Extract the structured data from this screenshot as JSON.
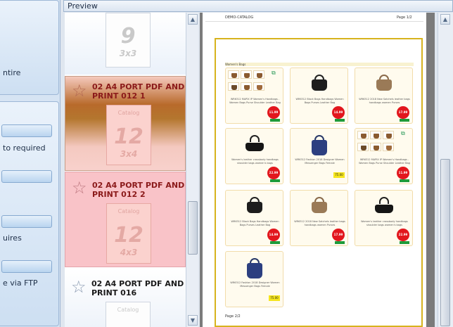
{
  "left_panel": {
    "texts": [
      "ntire",
      "to required",
      "uires",
      "e via FTP"
    ]
  },
  "preview": {
    "title": "Preview"
  },
  "templates": [
    {
      "title": "",
      "thumb_number": "9",
      "thumb_grid": "3x3",
      "selected": false
    },
    {
      "title": "02 A4 PORT PDF AND PRINT 012 1",
      "thumb_caption": "Catalog",
      "thumb_number": "12",
      "thumb_grid": "3x4",
      "selected": true
    },
    {
      "title": "02 A4 PORT PDF AND PRINT 012 2",
      "thumb_caption": "Catalog",
      "thumb_number": "12",
      "thumb_grid": "4x3",
      "selected": false,
      "hovered": true
    },
    {
      "title": "02 A4 PORT PDF AND PRINT 016",
      "thumb_caption": "Catalog",
      "selected": false
    }
  ],
  "page_preview": {
    "header_left": "DEMO-CATALOG",
    "header_right": "Page 1/2",
    "category_title": "Women's Bags",
    "footer_left": "Page 2/2",
    "cards": [
      {
        "desc": "WR6312 MAPIX IP Women's Handbags - Women Bags Purse Shoulder Leather Bag",
        "price": "11.99",
        "badge": "red"
      },
      {
        "desc": "WR6312 Black Bags Handbags Women Bags Purses Leather Bag",
        "price": "14.99",
        "badge": "red"
      },
      {
        "desc": "WR6312 2018 New Satchels leather bags handbags women Purses",
        "price": "17.99",
        "badge": "red"
      },
      {
        "desc": "Women's leather crossbody handbags shoulder bags women's bags",
        "price": "22.99",
        "badge": "red"
      },
      {
        "desc": "WR6312 Fashion 2018 Designer Women Messenger Bags Female",
        "price": "75.00",
        "badge": "yellow"
      },
      {
        "desc": "WR6312 MAPIX IP Women's Handbags - Women Bags Purse Shoulder Leather Bag",
        "price": "11.99",
        "badge": "red"
      },
      {
        "desc": "WR6312 Black Bags Handbags Women Bags Purses Leather Bag",
        "price": "14.99",
        "badge": "red"
      },
      {
        "desc": "WR6312 2018 New Satchels leather bags handbags women Purses",
        "price": "17.99",
        "badge": "red"
      },
      {
        "desc": "Women's leather crossbody handbags shoulder bags women's bags",
        "price": "22.99",
        "badge": "red"
      },
      {
        "desc": "WR6312 Fashion 2018 Designer Women Messenger Bags Female",
        "price": "75.00",
        "badge": "yellow"
      }
    ]
  },
  "colors": {
    "selected_title": "#8b1a1a",
    "badge_red": "#e2171d",
    "badge_yellow": "#f5e51d",
    "frame_gold": "#d7b31d"
  }
}
